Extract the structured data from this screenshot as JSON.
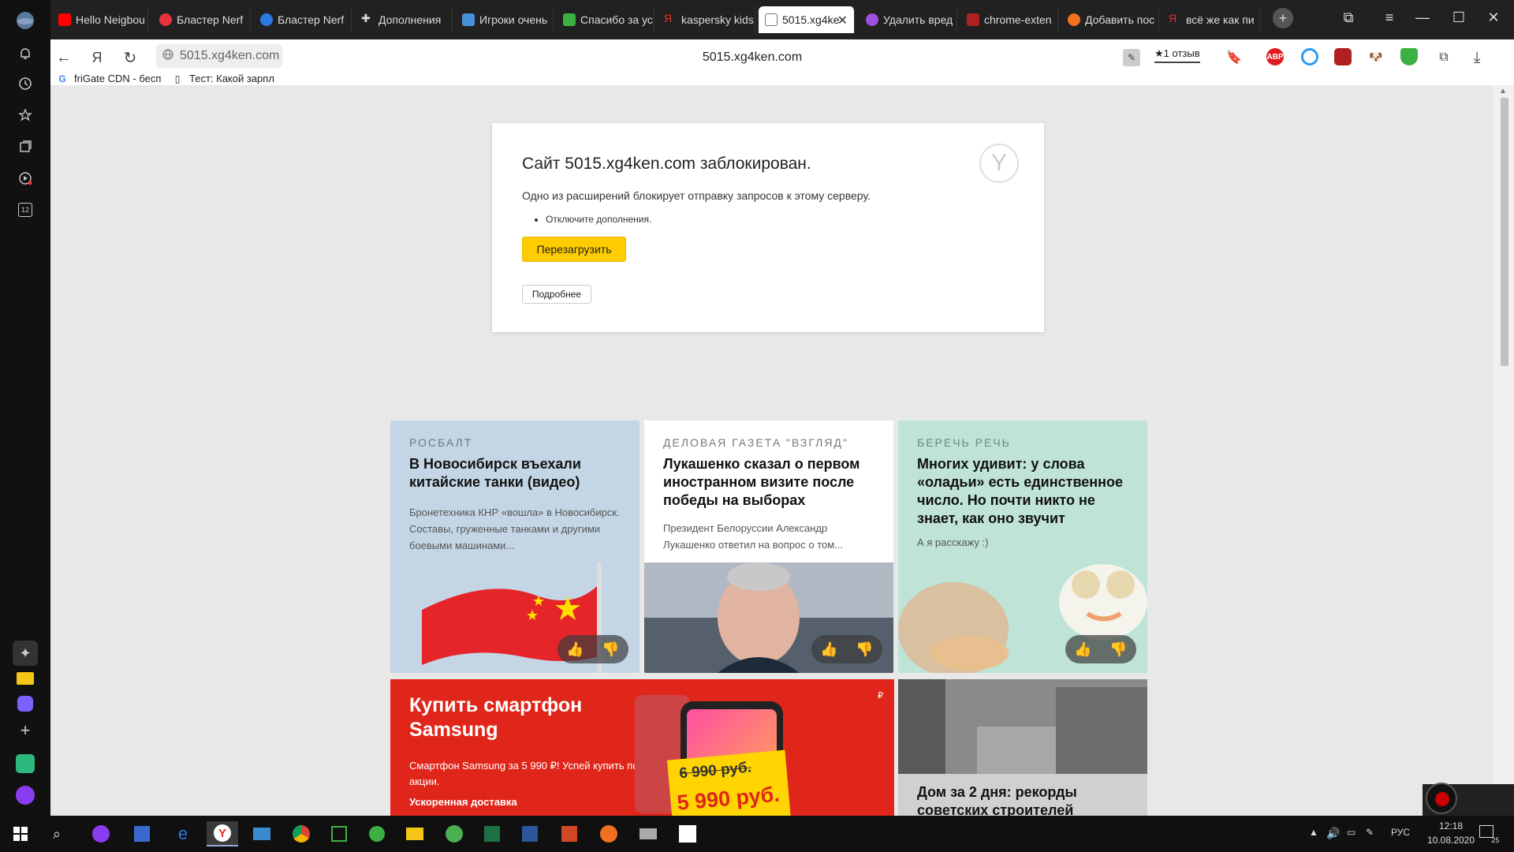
{
  "tabs": [
    {
      "title": "Hello Neigbou",
      "fav_color": "#ff0000"
    },
    {
      "title": "Бластер Nerf",
      "fav_color": "#e6323c"
    },
    {
      "title": "Бластер Nerf",
      "fav_color": "#2a7ae2"
    },
    {
      "title": "Дополнения",
      "fav_color": "#888888"
    },
    {
      "title": "Игроки очень",
      "fav_color": "#4a90d9"
    },
    {
      "title": "Спасибо за ус",
      "fav_color": "#3cb043"
    },
    {
      "title": "kaspersky kids",
      "fav_color": "#e03030"
    },
    {
      "title": "5015.xg4ke",
      "fav_color": "#ffffff",
      "active": true
    },
    {
      "title": "Удалить вред",
      "fav_color": "#a050e0"
    },
    {
      "title": "chrome-exten",
      "fav_color": "#b02020"
    },
    {
      "title": "Добавить пос",
      "fav_color": "#f07020"
    },
    {
      "title": "всё же как пи",
      "fav_color": "#e03030"
    }
  ],
  "toolbar": {
    "address": "5015.xg4ken.com",
    "page_title": "5015.xg4ken.com",
    "yandex_letter": "Я",
    "review": "★1 отзыв",
    "ext_abp": "ABP"
  },
  "bookmarks": [
    {
      "label": "friGate CDN - бесп",
      "icon": "G"
    },
    {
      "label": "Тест: Какой зарпл",
      "icon": "▯"
    }
  ],
  "error": {
    "title": "Сайт 5015.xg4ken.com заблокирован.",
    "description": "Одно из расширений блокирует отправку запросов к этому серверу.",
    "hint": "Отключите дополнения.",
    "reload_label": "Перезагрузить",
    "more_label": "Подробнее"
  },
  "cards": [
    {
      "source": "РОСБАЛТ",
      "title": "В Новосибирск въехали китайские танки (видео)",
      "snippet": "Бронетехника КНР «вошла» в Новосибирск. Составы, груженные танками и другими боевыми машинами..."
    },
    {
      "source": "ДЕЛОВАЯ ГАЗЕТА \"ВЗГЛЯД\"",
      "title": "Лукашенко сказал о первом иностранном визите после победы на выборах",
      "snippet": "Президент Белоруссии Александр Лукашенко ответил на вопрос о том..."
    },
    {
      "source": "БЕРЕЧЬ РЕЧЬ",
      "title": "Многих удивит: у слова «оладьи» есть единственное число. Но почти никто не знает, как оно звучит",
      "snippet": "А я расскажу :)"
    }
  ],
  "ad": {
    "title": "Купить смартфон Samsung",
    "text": "Смартфон Samsung за 5 990 ₽! Успей купить по акции.",
    "delivery": "Ускоренная доставка",
    "old_price": "6 990 руб.",
    "new_price": "5 990 руб.",
    "currency": "₽"
  },
  "bw_card": {
    "title": "Дом за 2 дня: рекорды советских строителей"
  },
  "tray": {
    "lang": "РУС",
    "time": "12:18",
    "date": "10.08.2020",
    "notif_count": "25",
    "badge_12": "12"
  }
}
